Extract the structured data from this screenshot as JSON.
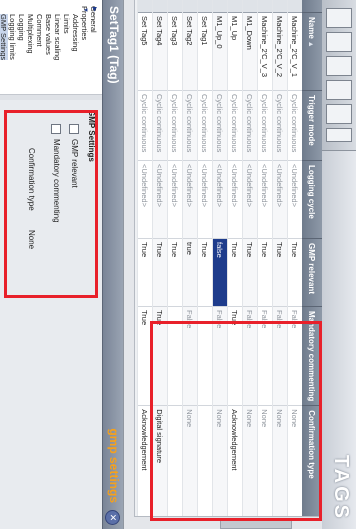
{
  "header": {
    "title": "TAGS"
  },
  "table": {
    "columns": [
      "Name",
      "Trigger mode",
      "Logging cycle",
      "GMP relevant",
      "Mandatory commenting",
      "Confirmation type"
    ],
    "rows": [
      [
        "Machine_2'C_V_1",
        "Cyclic continuous",
        "<Undefined>",
        "True",
        "False",
        "None"
      ],
      [
        "Machine_2'C_V_2",
        "Cyclic continuous",
        "<Undefined>",
        "True",
        "False",
        "None"
      ],
      [
        "Machine_2'C_V_3",
        "Cyclic continuous",
        "<Undefined>",
        "True",
        "False",
        "None"
      ],
      [
        "M1_Down",
        "Cyclic continuous",
        "<Undefined>",
        "True",
        "False",
        "None"
      ],
      [
        "M1_Up",
        "Cyclic continuous",
        "<Undefined>",
        "True",
        "True",
        "Acknowledgement"
      ],
      [
        "M1_Up_0",
        "Cyclic continuous",
        "<Undefined>",
        "false",
        "False",
        "None"
      ],
      [
        "Set Tag1",
        "Cyclic continuous",
        "<Undefined>",
        "True",
        "",
        ""
      ],
      [
        "Set Tag2",
        "Cyclic continuous",
        "<Undefined>",
        "true",
        "False",
        "None"
      ],
      [
        "Set Tag3",
        "Cyclic continuous",
        "<Undefined>",
        "True",
        "",
        ""
      ],
      [
        "Set Tag4",
        "Cyclic continuous",
        "<Undefined>",
        "True",
        "True",
        "Digital signature"
      ],
      [
        "Set Tag5",
        "Cyclic continuous",
        "<Undefined>",
        "True",
        "True",
        "Acknowledgement"
      ]
    ],
    "dropdown_options": [
      "False",
      "True"
    ]
  },
  "panel": {
    "title": "SetTag1 (Tag)",
    "gmp_label": "gmp settings",
    "tree": {
      "items": [
        "General",
        "Properties",
        "Addressing",
        "Limits",
        "Linear scaling",
        "Base values",
        "Comment",
        "Multiplexing",
        "Logging",
        "Logging limits",
        "GMP Settings"
      ]
    },
    "settings": {
      "section": "GMP Settings",
      "gmp_relevant": "GMP relevant",
      "mandatory": "Mandatory commenting",
      "confirmation_label": "Confirmation type",
      "confirmation_value": "None"
    }
  }
}
